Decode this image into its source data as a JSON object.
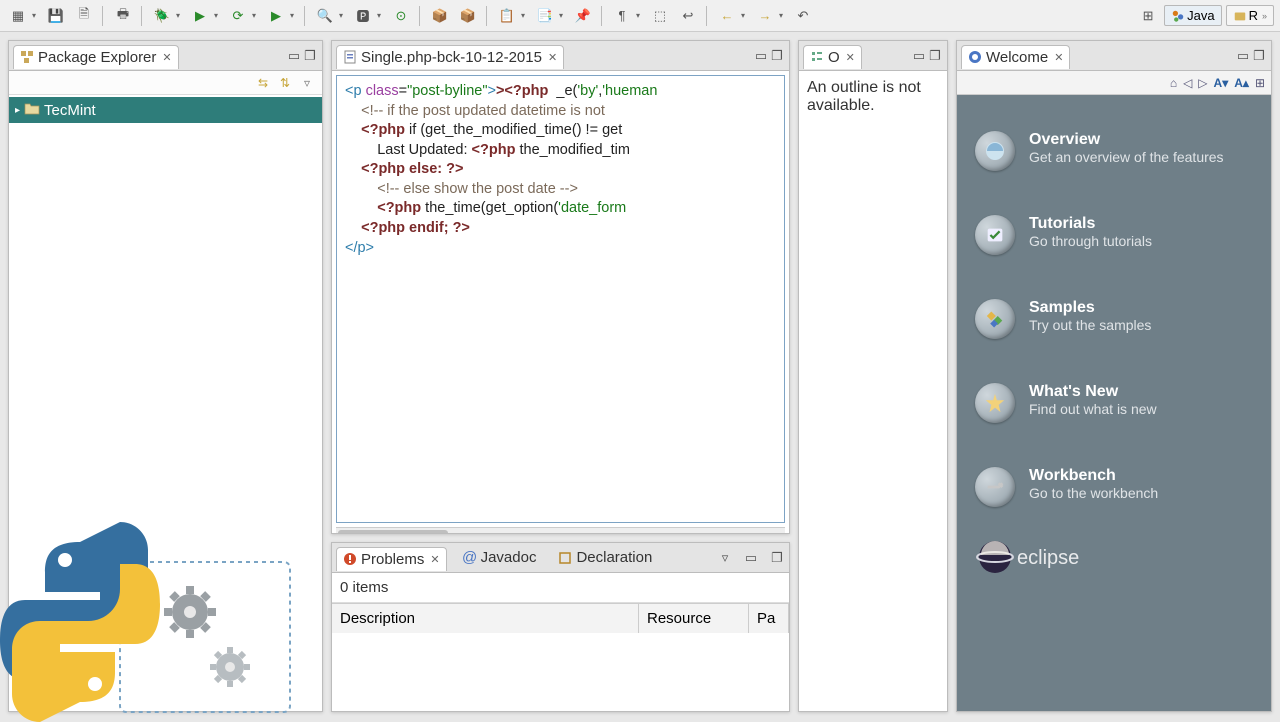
{
  "perspectives": {
    "java": "Java",
    "r": "R"
  },
  "package_explorer": {
    "title": "Package Explorer",
    "project": "TecMint"
  },
  "editor": {
    "filename": "Single.php-bck-10-12-2015",
    "lines": {
      "l1a": "<p ",
      "l1b": "class",
      "l1c": "=",
      "l1d": "\"post-byline\"",
      "l1e": "><?php",
      "l1f": "  _e(",
      "l1g": "'by'",
      "l1h": ",",
      "l1i": "'hueman",
      "l2a": "    ",
      "l2b": "<!-- if the post updated datetime is not",
      "l3a": "    ",
      "l3b": "<?php",
      "l3c": " if (get_the_modified_time() != get",
      "l4a": "        Last Updated: ",
      "l4b": "<?php",
      "l4c": " the_modified_tim",
      "l5a": "    ",
      "l5b": "<?php",
      "l5c": " else: ",
      "l5d": "?>",
      "l6a": "        ",
      "l6b": "<!-- else show the post date -->",
      "l7a": "        ",
      "l7b": "<?php",
      "l7c": " the_time(get_option(",
      "l7d": "'date_form",
      "l8a": "    ",
      "l8b": "<?php",
      "l8c": " endif; ",
      "l8d": "?>",
      "l9a": "</p>"
    }
  },
  "outline": {
    "title": "O",
    "message": "An outline is not available."
  },
  "bottom_panel": {
    "tabs": {
      "problems": "Problems",
      "javadoc": "Javadoc",
      "declaration": "Declaration"
    },
    "items_label": "0 items",
    "columns": {
      "description": "Description",
      "resource": "Resource",
      "path": "Pa"
    }
  },
  "welcome": {
    "title": "Welcome",
    "items": [
      {
        "title": "Overview",
        "subtitle": "Get an overview of the features"
      },
      {
        "title": "Tutorials",
        "subtitle": "Go through tutorials"
      },
      {
        "title": "Samples",
        "subtitle": "Try out the samples"
      },
      {
        "title": "What's New",
        "subtitle": "Find out what is new"
      },
      {
        "title": "Workbench",
        "subtitle": "Go to the workbench"
      }
    ],
    "logo": "eclipse"
  }
}
